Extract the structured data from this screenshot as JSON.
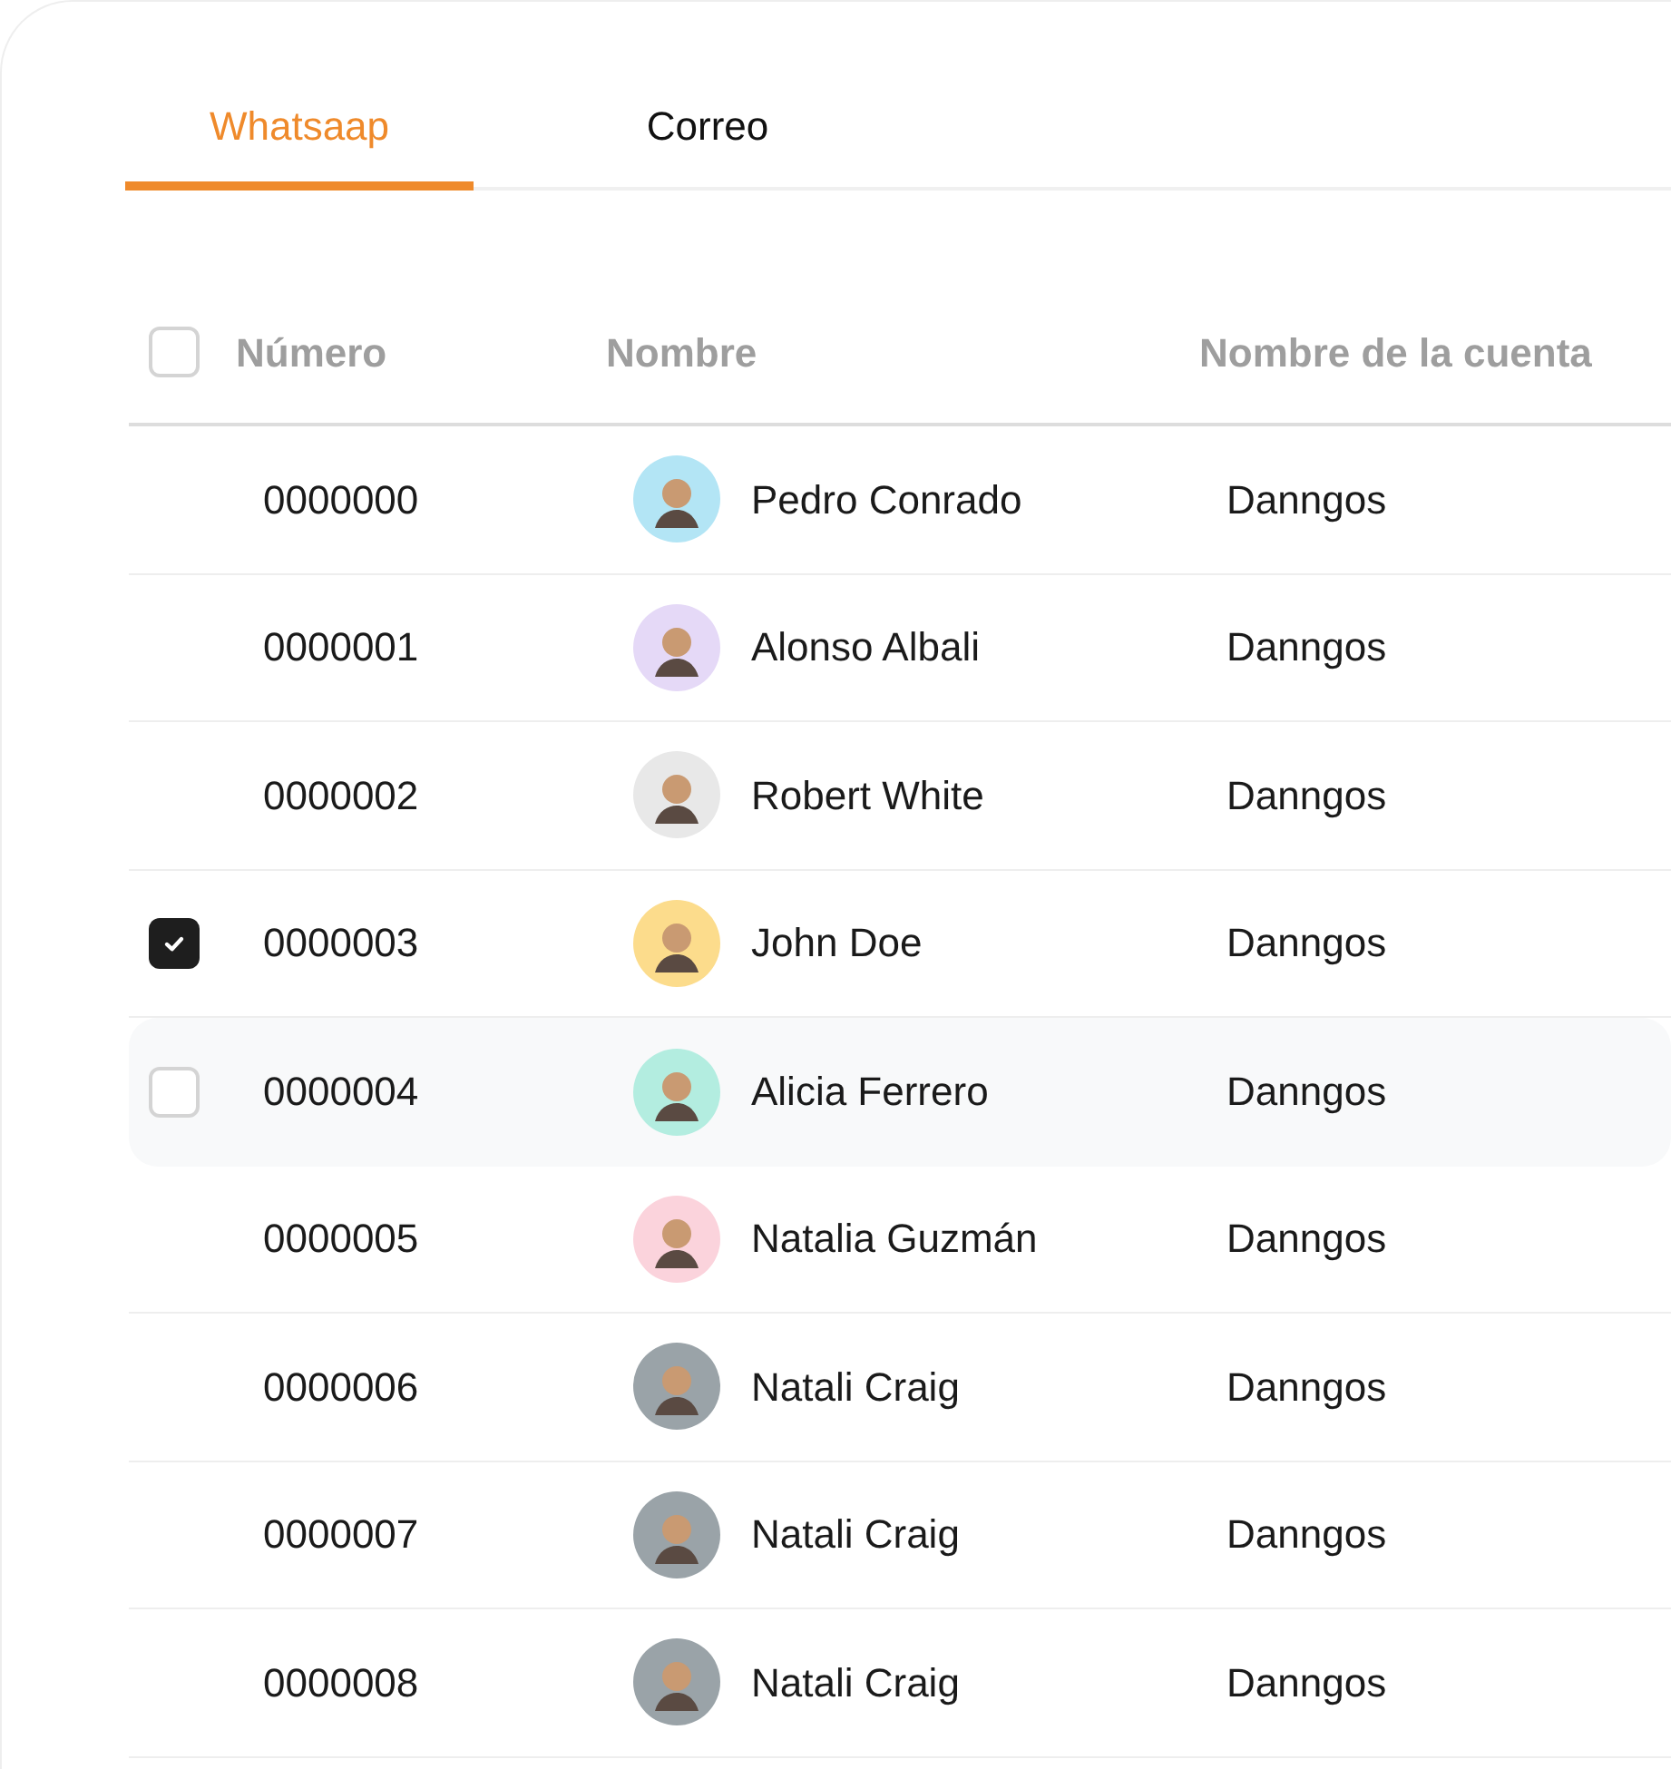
{
  "tabs": [
    {
      "label": "Whatsaap",
      "selected": true
    },
    {
      "label": "Correo",
      "selected": false
    }
  ],
  "table": {
    "select_all": {
      "checked": false
    },
    "columns": [
      "Número",
      "Nombre",
      "Nombre de la cuenta"
    ],
    "rows": [
      {
        "number": "0000000",
        "name": "Pedro Conrado",
        "account": "Danngos",
        "color": "#b3e5f5",
        "checked": false,
        "hovered": false
      },
      {
        "number": "0000001",
        "name": "Alonso Albali",
        "account": "Danngos",
        "color": "#e5d9f7",
        "checked": false,
        "hovered": false
      },
      {
        "number": "0000002",
        "name": "Robert White",
        "account": "Danngos",
        "color": "#e8e8e8",
        "checked": false,
        "hovered": false
      },
      {
        "number": "0000003",
        "name": "John Doe",
        "account": "Danngos",
        "color": "#fcdc8c",
        "checked": true,
        "hovered": false
      },
      {
        "number": "0000004",
        "name": "Alicia Ferrero",
        "account": "Danngos",
        "color": "#b3ede0",
        "checked": false,
        "hovered": true
      },
      {
        "number": "0000005",
        "name": "Natalia Guzmán",
        "account": "Danngos",
        "color": "#fbd3dc",
        "checked": false,
        "hovered": false
      },
      {
        "number": "0000006",
        "name": "Natali Craig",
        "account": "Danngos",
        "color": "#9aa3a8",
        "checked": false,
        "hovered": false
      },
      {
        "number": "0000007",
        "name": "Natali Craig",
        "account": "Danngos",
        "color": "#9aa3a8",
        "checked": false,
        "hovered": false
      },
      {
        "number": "0000008",
        "name": "Natali Craig",
        "account": "Danngos",
        "color": "#9aa3a8",
        "checked": false,
        "hovered": false
      }
    ]
  }
}
